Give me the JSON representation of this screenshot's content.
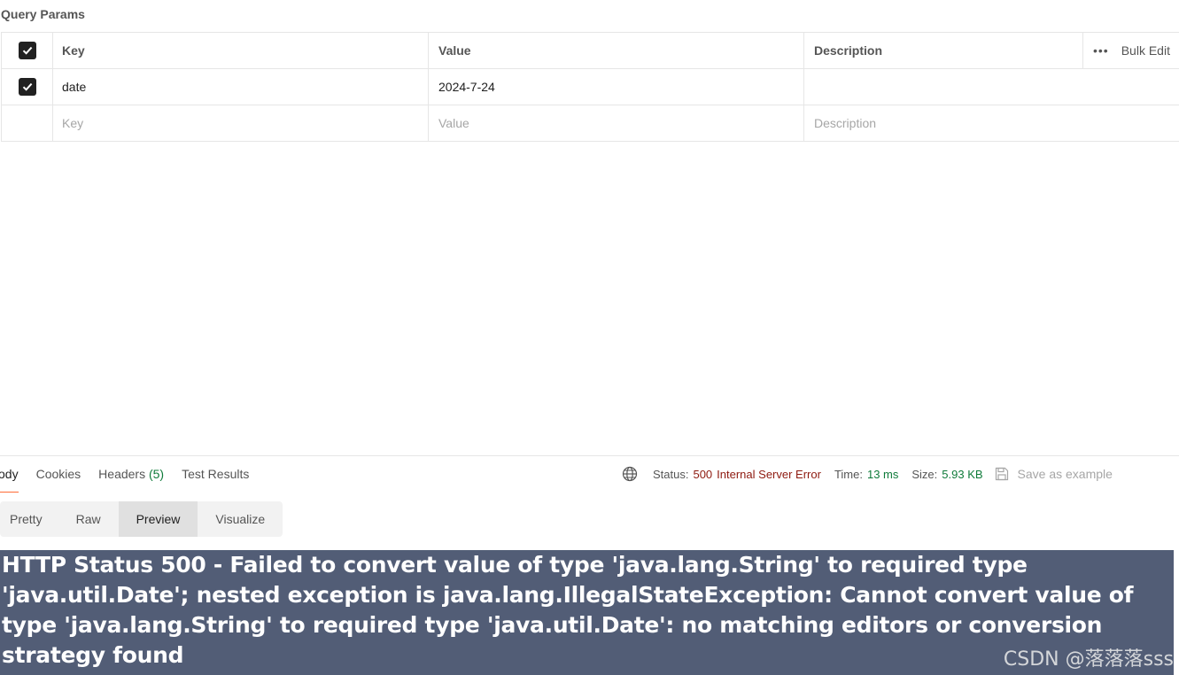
{
  "section_title": "Query Params",
  "table": {
    "headers": {
      "key": "Key",
      "value": "Value",
      "description": "Description",
      "bulk_edit": "Bulk Edit"
    },
    "rows": [
      {
        "checked": true,
        "key": "date",
        "value": "2024-7-24",
        "description": ""
      }
    ],
    "placeholders": {
      "key": "Key",
      "value": "Value",
      "description": "Description"
    }
  },
  "response": {
    "tabs": [
      {
        "label": "ody"
      },
      {
        "label": "Cookies"
      },
      {
        "label": "Headers",
        "count": "(5)"
      },
      {
        "label": "Test Results"
      }
    ],
    "status_label": "Status:",
    "status_code": "500",
    "status_text": "Internal Server Error",
    "time_label": "Time:",
    "time_value": "13 ms",
    "size_label": "Size:",
    "size_value": "5.93 KB",
    "save_example": "Save as example",
    "view_tabs": [
      "Pretty",
      "Raw",
      "Preview",
      "Visualize"
    ],
    "active_view": "Preview",
    "preview_heading": "HTTP Status 500 - Failed to convert value of type 'java.lang.String' to required type 'java.util.Date'; nested exception is java.lang.IllegalStateException: Cannot convert value of type 'java.lang.String' to required type 'java.util.Date': no matching editors or conversion strategy found"
  },
  "watermark": "CSDN @落落落sss",
  "colors": {
    "error": "#8e1a10",
    "success": "#0f7b3a",
    "preview_bg": "#525d76",
    "tab_accent": "#ff6c37"
  }
}
